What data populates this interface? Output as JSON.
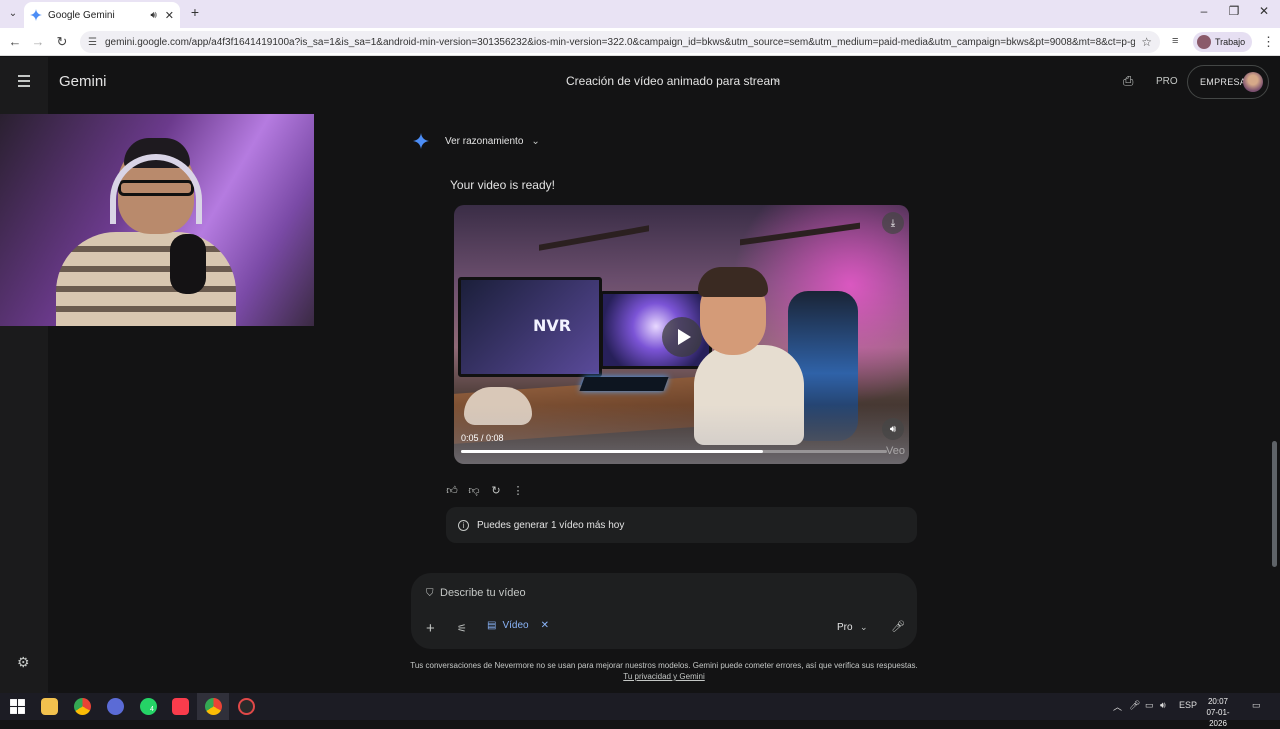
{
  "browser": {
    "tab_title": "Google Gemini",
    "url": "gemini.google.com/app/a4f3f1641419100a?is_sa=1&is_sa=1&android-min-version=301356232&ios-min-version=322.0&campaign_id=bkws&utm_source=sem&utm_medium=paid-media&utm_campaign=bkws&pt=9008&mt=8&ct=p-growth-se...",
    "profile_label": "Trabajo",
    "icons": [
      "tab-list-icon",
      "gemini-favicon",
      "audio-icon",
      "close-icon",
      "plus-icon",
      "minimize-icon",
      "restore-icon",
      "back-icon",
      "forward-icon",
      "reload-icon",
      "site-info-icon",
      "star-icon",
      "media-icon",
      "kebab-icon"
    ]
  },
  "header": {
    "brand": "Gemini",
    "chat_title": "Creación de vídeo animado para stream",
    "pro_label": "PRO",
    "empresa_label": "EMPRESA"
  },
  "message": {
    "reasoning_label": "Ver razonamiento",
    "ready_text": "Your video is ready!",
    "video": {
      "time": "0:05 / 0:08",
      "progress_fraction": 0.71,
      "watermark": "Veo",
      "monitor_logo": "NVR"
    },
    "limit_text": "Puedes generar 1 vídeo más hoy"
  },
  "composer": {
    "placeholder": "Describe tu vídeo",
    "chip_label": "Vídeo",
    "mode_label": "Pro"
  },
  "footer": {
    "disclaimer": "Tus conversaciones de Nevermore no se usan para mejorar nuestros modelos. Gemini puede cometer errores, así que verifica sus respuestas.",
    "privacy_link": "Tu privacidad y Gemini"
  },
  "taskbar": {
    "language": "ESP",
    "time": "20:07",
    "date": "07-01-2026",
    "whatsapp_badge": "4"
  },
  "colors": {
    "app_bg": "#131314",
    "accent_blue": "#8ab4f8",
    "chrome_tabbar": "#e9e3f4"
  }
}
